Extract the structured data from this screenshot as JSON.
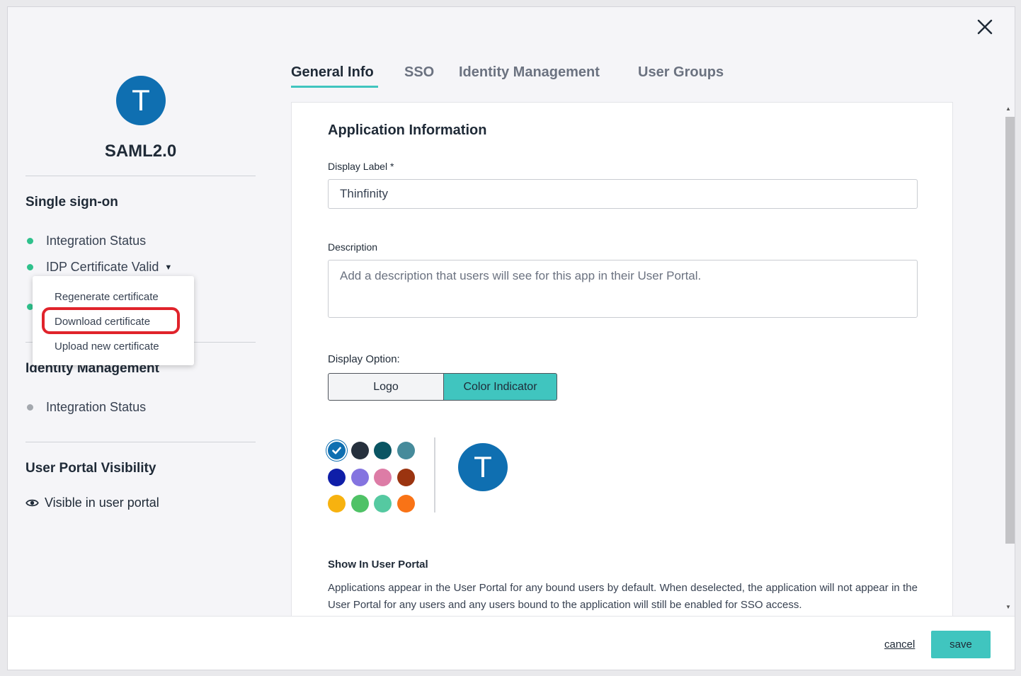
{
  "app": {
    "avatar_letter": "T",
    "name": "SAML2.0"
  },
  "sidebar": {
    "sso_section": {
      "title": "Single sign-on",
      "items": [
        {
          "label": "Integration Status",
          "status_color": "#2fc18c"
        },
        {
          "label": "IDP Certificate Valid",
          "status_color": "#2fc18c"
        }
      ]
    },
    "cert_menu": {
      "items": [
        "Regenerate certificate",
        "Download certificate",
        "Upload new certificate"
      ],
      "highlighted_item": "Download certificate"
    },
    "identity_section": {
      "title": "Identity Management",
      "items": [
        {
          "label": "Integration Status",
          "status_color": "#a4a8ae"
        }
      ]
    },
    "portal_section": {
      "title": "User Portal Visibility",
      "visibility_label": "Visible in user portal",
      "visibility_icon": "eye-icon"
    }
  },
  "tabs": [
    {
      "label": "General Info",
      "active": true
    },
    {
      "label": "SSO",
      "active": false
    },
    {
      "label": "Identity Management",
      "active": false
    },
    {
      "label": "User Groups",
      "active": false
    }
  ],
  "main": {
    "heading": "Application Information",
    "display_label": {
      "label": "Display Label *",
      "value": "Thinfinity"
    },
    "description": {
      "label": "Description",
      "placeholder": "Add a description that users will see for this app in their User Portal."
    },
    "display_option": {
      "label": "Display Option:",
      "options": [
        "Logo",
        "Color Indicator"
      ],
      "selected": "Color Indicator"
    },
    "color_palette": {
      "colors": [
        "#0f6fb1",
        "#26303d",
        "#0a5563",
        "#468b9b",
        "#0f1ea8",
        "#8474e0",
        "#dd7ca6",
        "#9b3410",
        "#f7b20f",
        "#4fc266",
        "#55c9a1",
        "#f97316"
      ],
      "selected": "#0f6fb1"
    },
    "preview_letter": "T",
    "show_in_portal": {
      "heading": "Show In User Portal",
      "text": "Applications appear in the User Portal for any bound users by default. When deselected, the application will not appear in the User Portal for any users and any users bound to the application will still be enabled for SSO access."
    }
  },
  "footer": {
    "cancel_label": "cancel",
    "save_label": "save"
  },
  "colors": {
    "accent": "#40c5bf",
    "avatar": "#0f6fb1",
    "highlight": "#e0232b"
  }
}
